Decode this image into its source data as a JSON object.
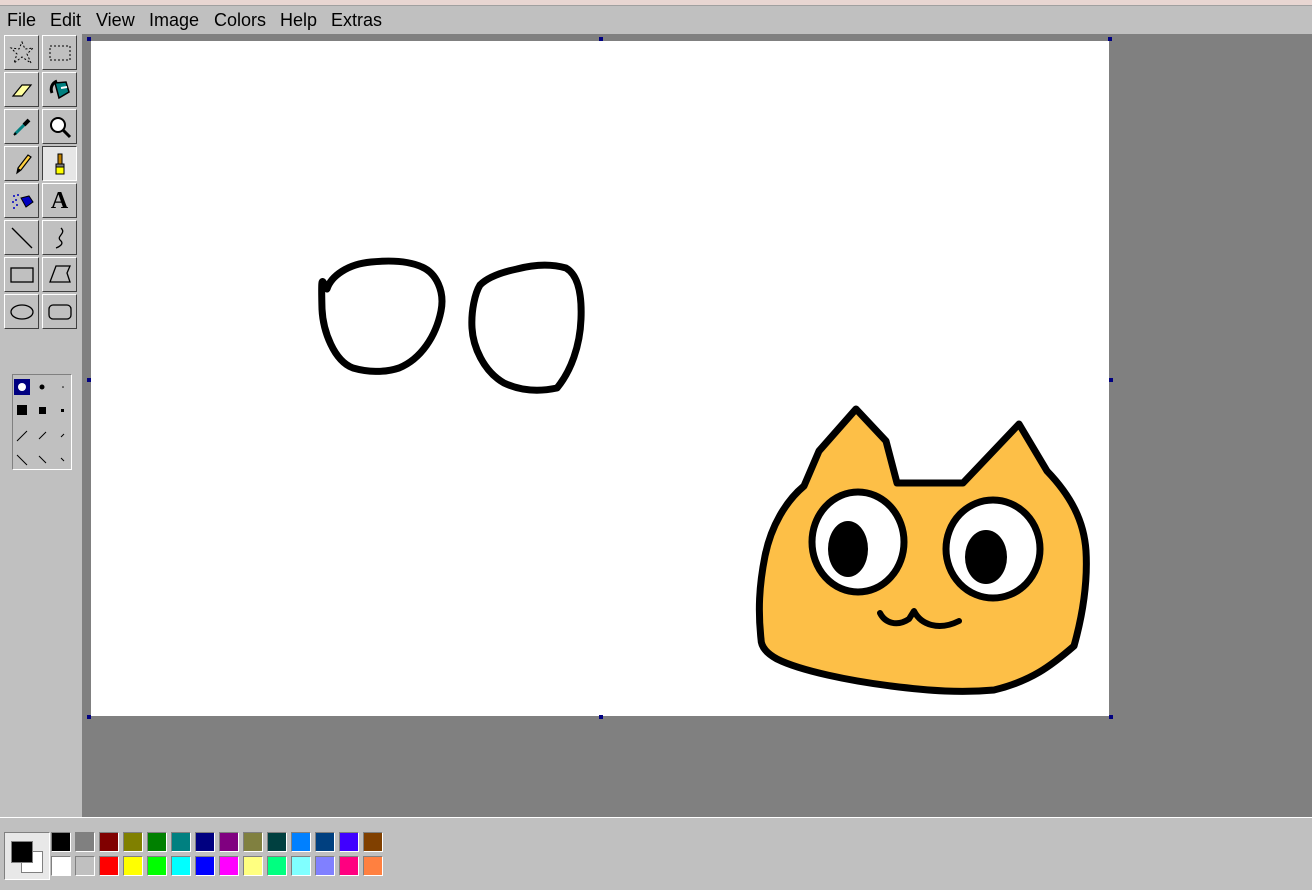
{
  "menu": [
    {
      "label": "File"
    },
    {
      "label": "Edit"
    },
    {
      "label": "View"
    },
    {
      "label": "Image"
    },
    {
      "label": "Colors"
    },
    {
      "label": "Help"
    },
    {
      "label": "Extras"
    }
  ],
  "tools": [
    {
      "name": "free-form-select",
      "icon": "free-select-icon",
      "pressed": false
    },
    {
      "name": "rect-select",
      "icon": "rect-select-icon",
      "pressed": false
    },
    {
      "name": "eraser",
      "icon": "eraser-icon",
      "pressed": false
    },
    {
      "name": "fill",
      "icon": "fill-bucket-icon",
      "pressed": false
    },
    {
      "name": "pick-color",
      "icon": "eyedropper-icon",
      "pressed": false
    },
    {
      "name": "magnifier",
      "icon": "magnifier-icon",
      "pressed": false
    },
    {
      "name": "pencil",
      "icon": "pencil-icon",
      "pressed": false
    },
    {
      "name": "brush",
      "icon": "brush-icon",
      "pressed": true
    },
    {
      "name": "airbrush",
      "icon": "airbrush-icon",
      "pressed": false
    },
    {
      "name": "text",
      "icon": "text-icon",
      "pressed": false
    },
    {
      "name": "line",
      "icon": "line-icon",
      "pressed": false
    },
    {
      "name": "curve",
      "icon": "curve-icon",
      "pressed": false
    },
    {
      "name": "rectangle",
      "icon": "rectangle-icon",
      "pressed": false
    },
    {
      "name": "polygon",
      "icon": "polygon-icon",
      "pressed": false
    },
    {
      "name": "ellipse",
      "icon": "ellipse-icon",
      "pressed": false
    },
    {
      "name": "rounded-rectangle",
      "icon": "rounded-rectangle-icon",
      "pressed": false
    }
  ],
  "text_tool_glyph": "A",
  "brush_options": {
    "selected": "large-round"
  },
  "colors": {
    "foreground": "#000000",
    "background": "#ffffff",
    "palette_row1": [
      "#000000",
      "#808080",
      "#800000",
      "#808000",
      "#008000",
      "#008080",
      "#000080",
      "#800080",
      "#808040",
      "#004040",
      "#0080ff",
      "#004080",
      "#4000ff",
      "#804000"
    ],
    "palette_row2": [
      "#ffffff",
      "#c0c0c0",
      "#ff0000",
      "#ffff00",
      "#00ff00",
      "#00ffff",
      "#0000ff",
      "#ff00ff",
      "#ffff80",
      "#00ff80",
      "#80ffff",
      "#8080ff",
      "#ff0080",
      "#ff8040"
    ]
  },
  "canvas_art": {
    "fill_color": "#fdbf47",
    "outline_color": "#000000"
  }
}
